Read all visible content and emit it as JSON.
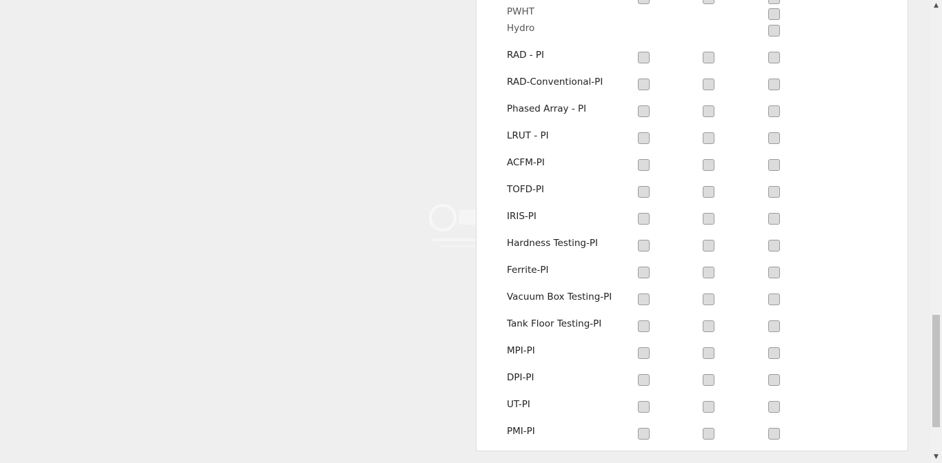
{
  "partial_rows": [
    {
      "label": "PWHT",
      "checked": [
        false
      ]
    },
    {
      "label": "Hydro",
      "checked": [
        false
      ]
    }
  ],
  "rows": [
    {
      "label": "RAD - PI",
      "checked": [
        false,
        false,
        false
      ]
    },
    {
      "label": "RAD-Conventional-PI",
      "checked": [
        false,
        false,
        false
      ]
    },
    {
      "label": "Phased Array - PI",
      "checked": [
        false,
        false,
        false
      ]
    },
    {
      "label": "LRUT - PI",
      "checked": [
        false,
        false,
        false
      ]
    },
    {
      "label": "ACFM-PI",
      "checked": [
        false,
        false,
        false
      ]
    },
    {
      "label": "TOFD-PI",
      "checked": [
        false,
        false,
        false
      ]
    },
    {
      "label": "IRIS-PI",
      "checked": [
        false,
        false,
        false
      ]
    },
    {
      "label": "Hardness Testing-PI",
      "checked": [
        false,
        false,
        false
      ]
    },
    {
      "label": "Ferrite-PI",
      "checked": [
        false,
        false,
        false
      ]
    },
    {
      "label": "Vacuum Box Testing-PI",
      "checked": [
        false,
        false,
        false
      ]
    },
    {
      "label": "Tank Floor Testing-PI",
      "checked": [
        false,
        false,
        false
      ]
    },
    {
      "label": "MPI-PI",
      "checked": [
        false,
        false,
        false
      ]
    },
    {
      "label": "DPI-PI",
      "checked": [
        false,
        false,
        false
      ]
    },
    {
      "label": "UT-PI",
      "checked": [
        false,
        false,
        false
      ]
    },
    {
      "label": "PMI-PI",
      "checked": [
        false,
        false,
        false
      ]
    }
  ],
  "scrollbar": {
    "up_icon": "scroll-up-icon",
    "down_icon": "scroll-down-icon"
  }
}
